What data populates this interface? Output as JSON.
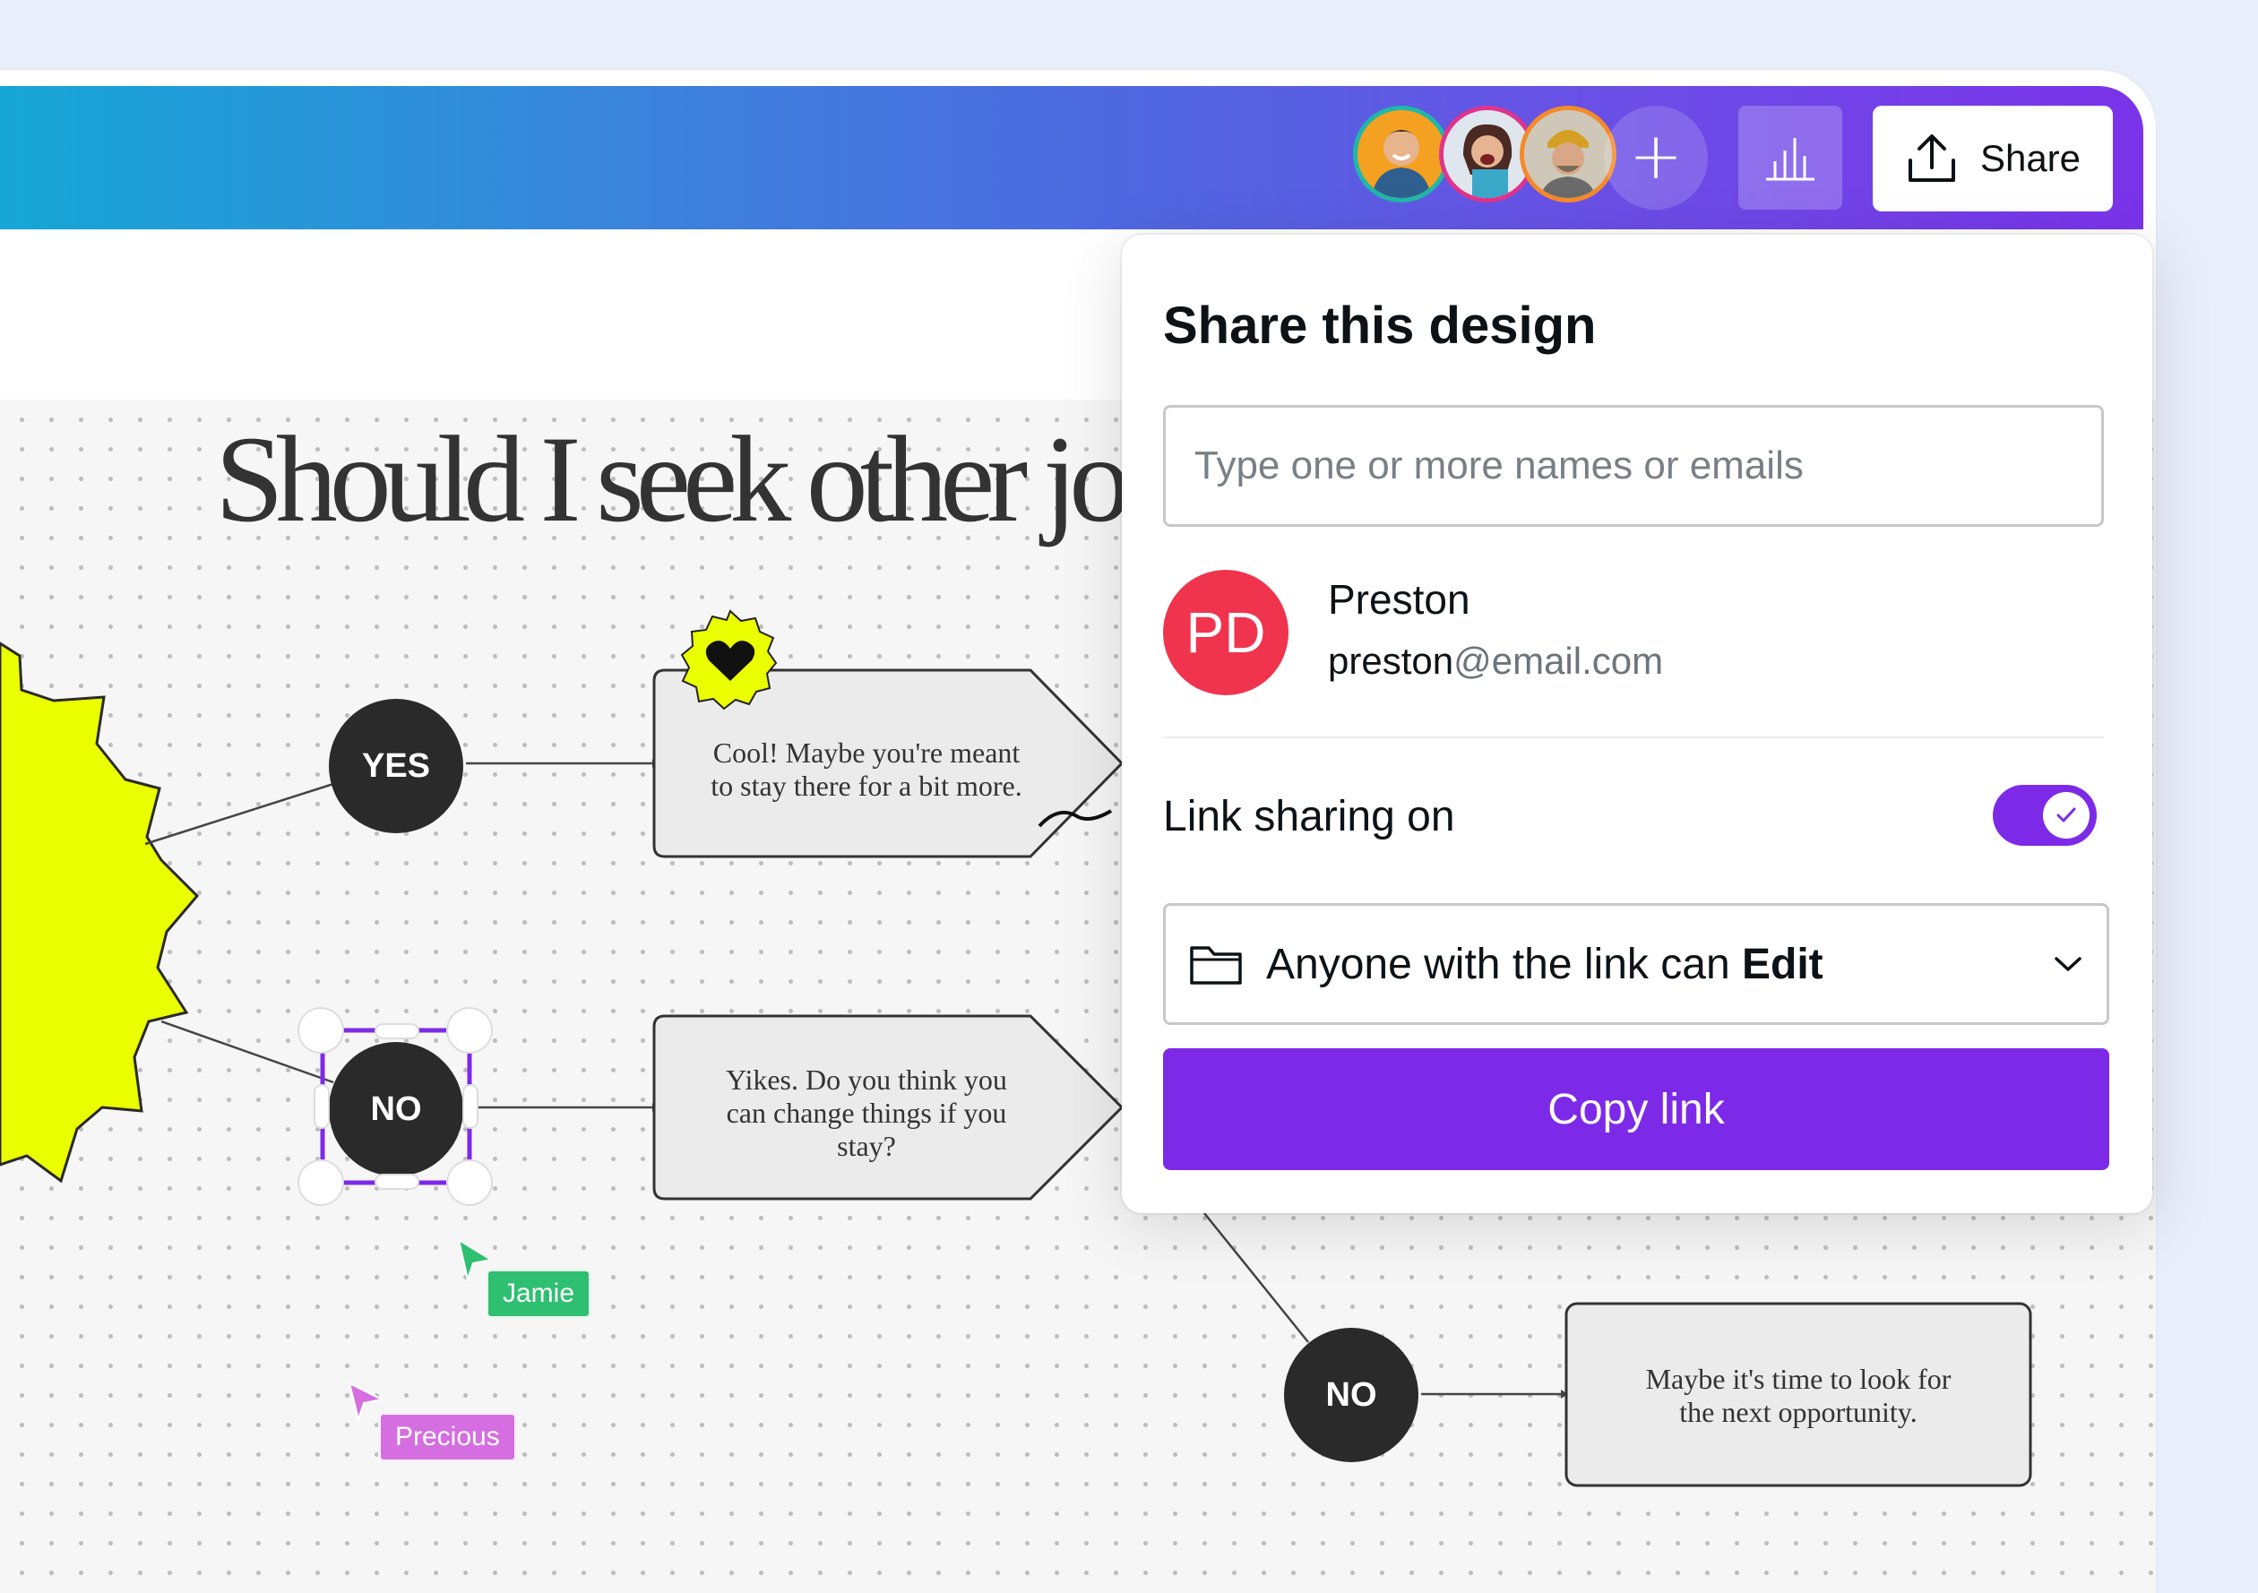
{
  "topbar": {
    "collaborators": [
      {
        "name": "collaborator-1",
        "ring": "#1fb8a8"
      },
      {
        "name": "collaborator-2",
        "ring": "#e0348c"
      },
      {
        "name": "collaborator-3",
        "ring": "#f58a2a"
      }
    ],
    "add_icon": "plus-icon",
    "insights_icon": "bar-chart-icon",
    "share_label": "Share",
    "share_icon": "upload-icon",
    "gradient": [
      "#16a7d6",
      "#7b33ea"
    ]
  },
  "canvas": {
    "title": "Should I seek other jo",
    "nodes": {
      "yes_label": "YES",
      "no_label": "NO",
      "no2_label": "NO"
    },
    "boxes": {
      "box1_line1": "Cool! Maybe you're meant",
      "box1_line2": "to stay there for a bit more.",
      "box2_line1": "Yikes. Do you think you",
      "box2_line2": "can change things if you",
      "box2_line3": "stay?",
      "box3_line1": "Maybe it's time to look for",
      "box3_line2": "the next opportunity."
    },
    "cursors": [
      {
        "label": "Jamie",
        "color": "#2fbf71"
      },
      {
        "label": "Precious",
        "color": "#d56ee0"
      }
    ],
    "sticker_icon": "heart-icon",
    "starburst_color": "#eaff00",
    "selection_color": "#7d2ae8"
  },
  "share_panel": {
    "title": "Share this design",
    "input_placeholder": "Type one or more names or emails",
    "person": {
      "initials": "PD",
      "name": "Preston",
      "email_user": "preston",
      "email_domain": "@email.com",
      "avatar_color": "#f0344e"
    },
    "link_sharing_label": "Link sharing on",
    "link_sharing_on": true,
    "permission_prefix": "Anyone with the link can ",
    "permission_value": "Edit",
    "copy_label": "Copy link",
    "accent": "#7d2ae8"
  }
}
